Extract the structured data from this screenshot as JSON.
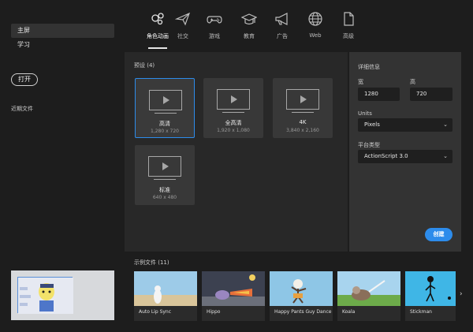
{
  "sidebar": {
    "items": [
      {
        "label": "主屏",
        "active": true
      },
      {
        "label": "学习",
        "active": false
      }
    ],
    "open_button": "打开",
    "recent_label": "近期文件"
  },
  "tabs": [
    {
      "label": "角色动画",
      "icon": "character-animation-icon",
      "active": true
    },
    {
      "label": "社交",
      "icon": "paper-plane-icon",
      "active": false
    },
    {
      "label": "游戏",
      "icon": "gamepad-icon",
      "active": false
    },
    {
      "label": "教育",
      "icon": "graduation-cap-icon",
      "active": false
    },
    {
      "label": "广告",
      "icon": "megaphone-icon",
      "active": false
    },
    {
      "label": "Web",
      "icon": "globe-icon",
      "active": false
    },
    {
      "label": "高级",
      "icon": "document-icon",
      "active": false
    }
  ],
  "presets": {
    "title": "预设 (4)",
    "cards": [
      {
        "name": "高清",
        "dims": "1,280 x 720",
        "selected": true
      },
      {
        "name": "全高清",
        "dims": "1,920 x 1,080",
        "selected": false
      },
      {
        "name": "4K",
        "dims": "3,840 x 2,160",
        "selected": false
      },
      {
        "name": "标准",
        "dims": "640 x 480",
        "selected": false
      }
    ]
  },
  "details": {
    "title": "详细信息",
    "width_label": "宽",
    "width_value": "1280",
    "height_label": "高",
    "height_value": "720",
    "units_label": "Units",
    "units_value": "Pixels",
    "platform_label": "平台类型",
    "platform_value": "ActionScript 3.0",
    "create_button": "创建"
  },
  "samples": {
    "title": "示例文件 (11)",
    "items": [
      {
        "name": "Auto Lip Sync"
      },
      {
        "name": "Hippo"
      },
      {
        "name": "Happy Pants Guy Dance"
      },
      {
        "name": "Koala"
      },
      {
        "name": "Stickman"
      }
    ]
  },
  "colors": {
    "accent": "#2d8ceb",
    "background": "#1d1d1d",
    "panel": "#282828",
    "details_panel": "#333333"
  }
}
